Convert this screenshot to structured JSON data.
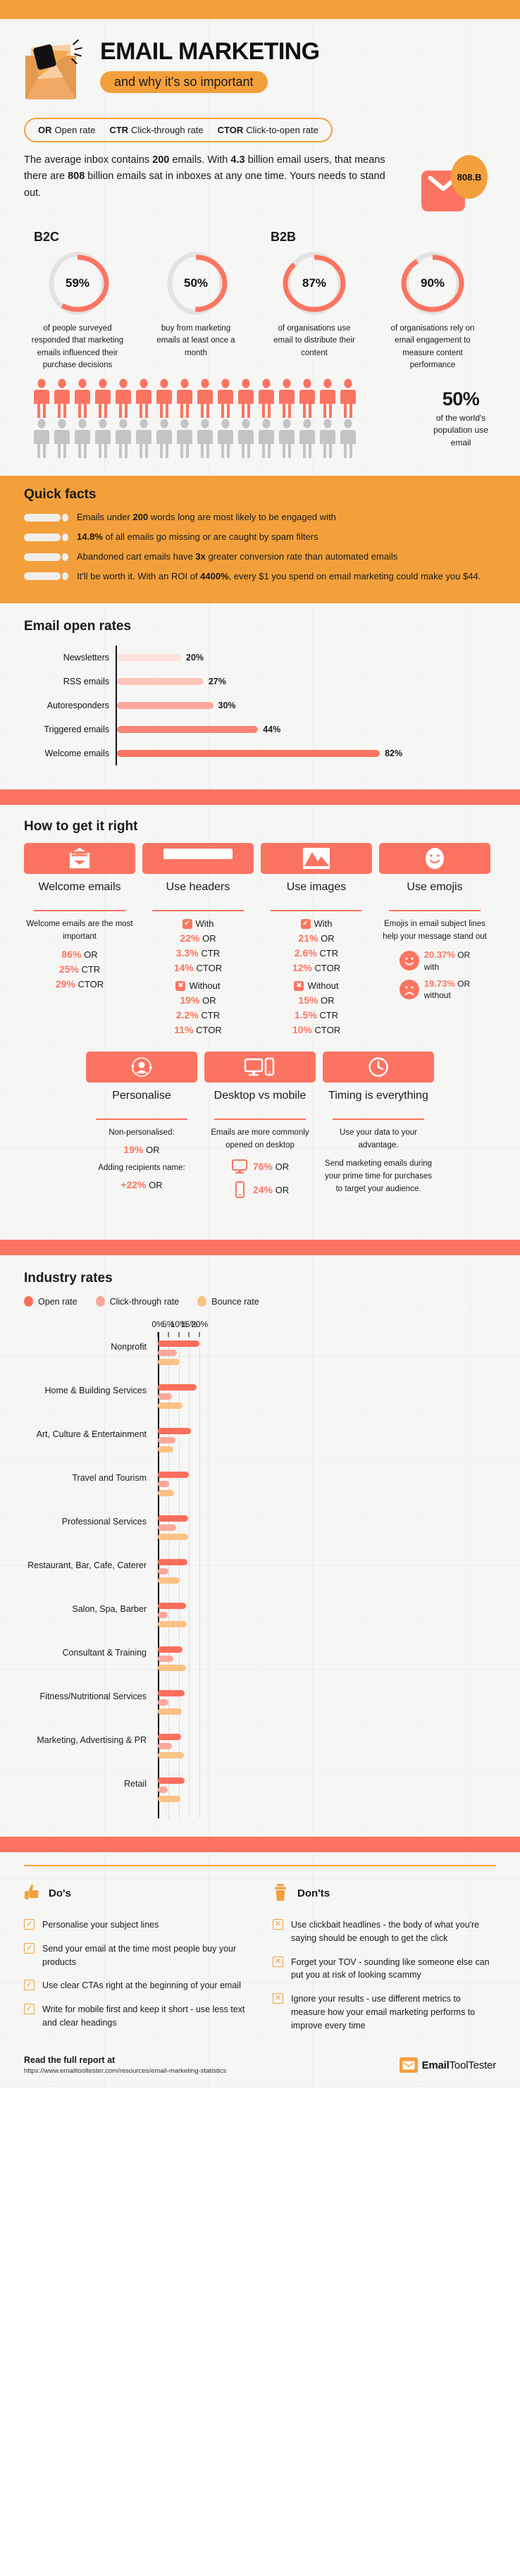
{
  "header": {
    "title": "EMAIL MARKETING",
    "subtitle": "and why it's so important",
    "logo_icon": "megaphone-envelope-icon"
  },
  "glossary": [
    {
      "abbr": "OR",
      "term": "Open rate"
    },
    {
      "abbr": "CTR",
      "term": "Click-through rate"
    },
    {
      "abbr": "CTOR",
      "term": "Click-to-open rate"
    }
  ],
  "intro": {
    "text_parts": [
      "The average inbox contains ",
      "200",
      " emails. With ",
      "4.3",
      " billion email users, that means there are ",
      "808",
      " billion emails sat in inboxes at any one time. Yours needs to stand out."
    ],
    "badge": "808.B",
    "icon": "envelope-icon"
  },
  "donuts": {
    "group_labels": {
      "b2c": "B2C",
      "b2b": "B2B"
    },
    "items": [
      {
        "value": 59,
        "display": "59%",
        "caption": "of people surveyed responded that marketing emails influenced their purchase decisions"
      },
      {
        "value": 50,
        "display": "50%",
        "caption": "buy from marketing emails at least once a month"
      },
      {
        "value": 87,
        "display": "87%",
        "caption": "of organisations use email to distribute their content"
      },
      {
        "value": 90,
        "display": "90%",
        "caption": "of organisations rely on email engagement to measure content performance"
      }
    ]
  },
  "population": {
    "highlight": "50%",
    "caption": "of the world's population use email",
    "filled_count": 16,
    "empty_count": 16,
    "filled_color": "#fb7461",
    "empty_color": "#c4c4c4"
  },
  "quick_facts": {
    "title": "Quick facts",
    "items": [
      {
        "pre": "Emails under ",
        "bold": "200",
        "post": " words long are most likely to be engaged with"
      },
      {
        "pre": "",
        "bold": "14.8%",
        "post": " of all emails go missing or are caught by spam filters"
      },
      {
        "pre": "Abandoned cart emails have ",
        "bold": "3x",
        "post": " greater conversion rate than automated emails"
      },
      {
        "pre": "It'll be worth it. With an ROI of ",
        "bold": "4400%",
        "post": ", every $1 you spend on email marketing could make you $44."
      }
    ]
  },
  "chart_data": [
    {
      "type": "bar",
      "orientation": "horizontal",
      "title": "Email open rates",
      "xlabel": "",
      "ylabel": "",
      "categories": [
        "Newsletters",
        "RSS emails",
        "Autoresponders",
        "Triggered emails",
        "Welcome emails"
      ],
      "values": [
        20,
        27,
        30,
        44,
        82
      ],
      "value_labels": [
        "20%",
        "27%",
        "30%",
        "44%",
        "82%"
      ],
      "bar_colors": [
        "#fde0da",
        "#fcc6bd",
        "#fba79b",
        "#fb8675",
        "#fb7461"
      ],
      "xlim": [
        0,
        100
      ],
      "grid": false,
      "legend": "none"
    },
    {
      "type": "bar",
      "orientation": "horizontal",
      "title": "Industry rates",
      "xlabel": "",
      "ylabel": "",
      "xlim": [
        0,
        21
      ],
      "xticks": [
        0,
        5,
        10,
        15,
        20
      ],
      "xtick_labels": [
        "0%",
        "5%",
        "10%",
        "15%",
        "20%"
      ],
      "grid": true,
      "legend": "top-left",
      "categories": [
        "Nonprofit",
        "Home & Building Services",
        "Art, Culture &  Entertainment",
        "Travel and Tourism",
        "Professional Services",
        "Restaurant, Bar, Cafe, Caterer",
        "Salon, Spa, Barber",
        "Consultant & Training",
        "Fitness/Nutritional Services",
        "Marketing, Advertising & PR",
        "Retail"
      ],
      "series": [
        {
          "name": "Open rate",
          "color": "#fb6e5c",
          "values": [
            20.0,
            18.5,
            16.0,
            15.0,
            14.6,
            14.1,
            13.6,
            11.8,
            12.8,
            11.0,
            12.7
          ]
        },
        {
          "name": "Click-through rate",
          "color": "#fba79b",
          "values": [
            9.0,
            6.8,
            8.5,
            5.3,
            8.7,
            5.2,
            4.8,
            7.6,
            5.0,
            6.7,
            4.6
          ]
        },
        {
          "name": "Bounce rate",
          "color": "#fbc286",
          "values": [
            10.4,
            11.8,
            7.3,
            7.9,
            14.4,
            10.4,
            14.0,
            13.6,
            11.6,
            12.6,
            10.9
          ]
        }
      ]
    }
  ],
  "how_to": {
    "title": "How to get it right",
    "cards_row1": [
      {
        "icon": "welcome-envelope-icon",
        "title": "Welcome emails",
        "body": "Welcome emails are the most important",
        "stats": [
          {
            "n": "86%",
            "t": "OR"
          },
          {
            "n": "25%",
            "t": "CTR"
          },
          {
            "n": "29%",
            "t": "CTOR"
          }
        ]
      },
      {
        "icon": "header-bar-icon",
        "title": "Use headers",
        "with_label": "With",
        "without_label": "Without",
        "with_stats": [
          {
            "n": "22%",
            "t": "OR"
          },
          {
            "n": "3.3%",
            "t": "CTR"
          },
          {
            "n": "14%",
            "t": "CTOR"
          }
        ],
        "without_stats": [
          {
            "n": "19%",
            "t": "OR"
          },
          {
            "n": "2.2%",
            "t": "CTR"
          },
          {
            "n": "11%",
            "t": "CTOR"
          }
        ]
      },
      {
        "icon": "image-mountain-icon",
        "title": "Use images",
        "with_label": "With",
        "without_label": "Without",
        "with_stats": [
          {
            "n": "21%",
            "t": "OR"
          },
          {
            "n": "2.6%",
            "t": "CTR"
          },
          {
            "n": "12%",
            "t": "CTOR"
          }
        ],
        "without_stats": [
          {
            "n": "15%",
            "t": "OR"
          },
          {
            "n": "1.5%",
            "t": "CTR"
          },
          {
            "n": "10%",
            "t": "CTOR"
          }
        ]
      },
      {
        "icon": "smiley-face-icon",
        "title": "Use emojis",
        "body": "Emojis in email subject lines help your message stand out",
        "emoji_stats": [
          {
            "face": "happy-face-icon",
            "n": "20.37%",
            "unit": "OR",
            "qualifier": "with"
          },
          {
            "face": "sad-face-icon",
            "n": "19.73%",
            "unit": "OR",
            "qualifier": "without"
          }
        ]
      }
    ],
    "cards_row2": [
      {
        "icon": "person-refresh-icon",
        "title": "Personalise",
        "lines": [
          "Non-personalised:"
        ],
        "stats": [
          {
            "n": "19%",
            "t": "OR"
          }
        ],
        "lines2": [
          "Adding recipients name:"
        ],
        "stats2": [
          {
            "n": "+22%",
            "t": "OR"
          }
        ]
      },
      {
        "icon": "desktop-mobile-icon",
        "title": "Desktop vs mobile",
        "body": "Emails are more commonly opened on desktop",
        "device_stats": [
          {
            "device": "monitor-icon",
            "n": "76%",
            "t": "OR"
          },
          {
            "device": "phone-icon",
            "n": "24%",
            "t": "OR"
          }
        ]
      },
      {
        "icon": "clock-icon",
        "title": "Timing is everything",
        "body": "Use your data to your advantage.",
        "body2": "Send marketing emails during your prime time for purchases to target your audience."
      }
    ]
  },
  "dos_donts": {
    "dos": {
      "title": "Do's",
      "icon": "thumbs-up-icon",
      "items": [
        "Personalise your subject lines",
        "Send your email at the time most people buy your products",
        "Use clear CTAs right at the beginning of your email",
        "Write for mobile first and keep it short - use less text and clear headings"
      ]
    },
    "donts": {
      "title": "Don'ts",
      "icon": "trash-bin-icon",
      "items": [
        "Use clickbait headlines - the body of what you're saying should be enough to get the click",
        "Forget your TOV - sounding like someone else can put you at risk of looking scammy",
        "Ignore your results - use different metrics to measure how your email marketing performs to improve every time"
      ]
    }
  },
  "footer": {
    "cta": "Read the full report at",
    "url": "https://www.emailtooltester.com/resources/email-marketing-statistics",
    "brand": "Email",
    "brand2": "ToolTester",
    "brand_icon": "envelope-logo-icon"
  },
  "colors": {
    "orange": "#f3a03c",
    "salmon": "#fb7461",
    "peach": "#fba79b",
    "sand": "#fbc286",
    "bg": "#f6f6f4"
  }
}
